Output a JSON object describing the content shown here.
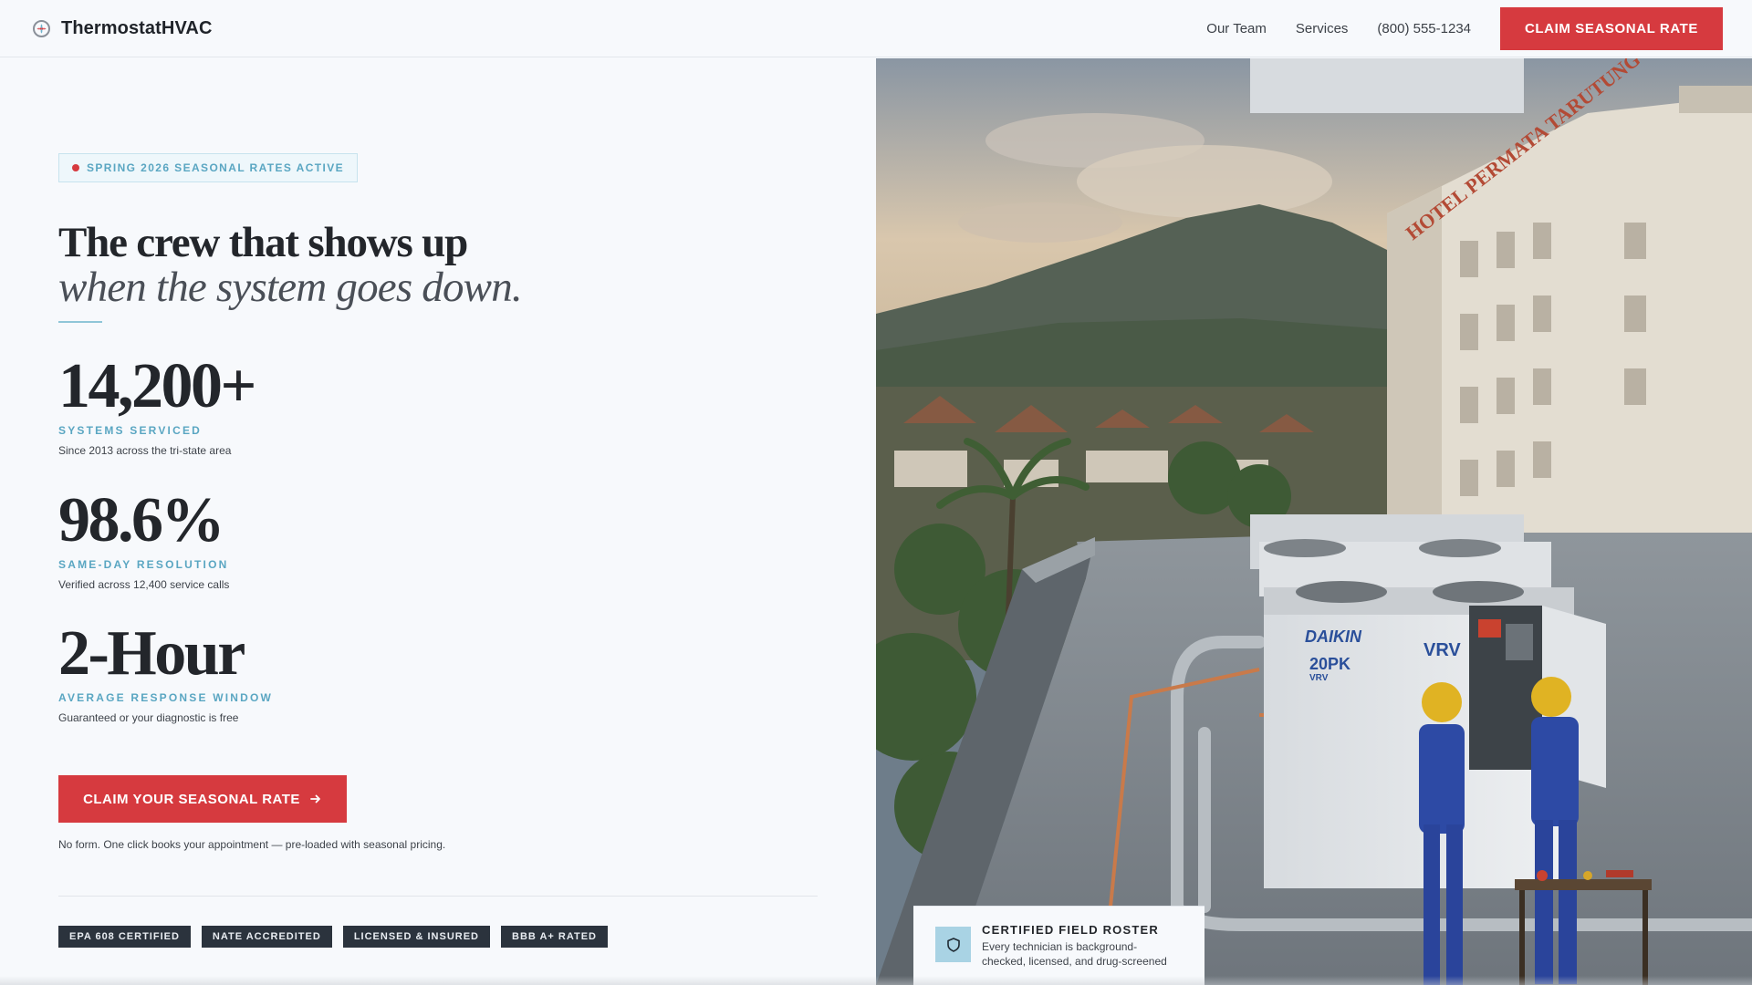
{
  "header": {
    "brand_name": "ThermostatHVAC",
    "brand_icon": "fan-icon",
    "nav": [
      "Our Team",
      "Services"
    ],
    "phone": "(800) 555-1234",
    "cta_label": "CLAIM SEASONAL RATE"
  },
  "hero": {
    "badge": "SPRING 2026 SEASONAL RATES ACTIVE",
    "headline_line1": "The crew that shows up",
    "headline_line2": "when the system goes down.",
    "stats": [
      {
        "value": "14,200+",
        "label": "SYSTEMS SERVICED",
        "desc": "Since 2013 across the tri-state area"
      },
      {
        "value": "98.6%",
        "label": "SAME-DAY RESOLUTION",
        "desc": "Verified across 12,400 service calls"
      },
      {
        "value": "2-Hour",
        "label": "AVERAGE RESPONSE WINDOW",
        "desc": "Guaranteed or your diagnostic is free"
      }
    ],
    "cta_label": "CLAIM YOUR SEASONAL RATE",
    "cta_note": "No form. One click books your appointment — pre-loaded with seasonal pricing.",
    "certifications": [
      "EPA 608 CERTIFIED",
      "NATE ACCREDITED",
      "LICENSED & INSURED",
      "BBB A+ RATED"
    ]
  },
  "photo": {
    "hotel_sign": "HOTEL PERMATA TARUTUNG",
    "unit_brand": "DAIKIN",
    "unit_model": "VRV",
    "unit_capacity": "20PK",
    "unit_sub": "VRV"
  },
  "roster_card": {
    "icon": "shield-icon",
    "title": "CERTIFIED FIELD ROSTER",
    "desc": "Every technician is background-checked, licensed, and drug-screened"
  },
  "colors": {
    "accent_red": "#d63a3f",
    "accent_teal": "#5aa6c2",
    "dark": "#23262b",
    "badge_dark": "#2b333d"
  }
}
